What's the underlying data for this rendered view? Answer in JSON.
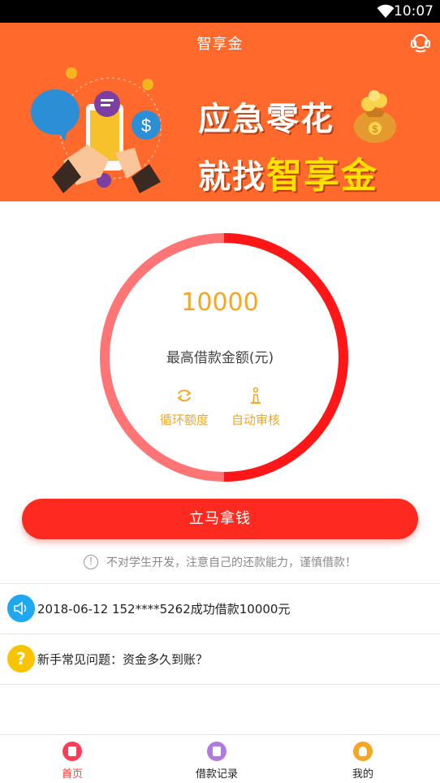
{
  "status_bar": {
    "time": "10:07"
  },
  "header": {
    "title": "智享金",
    "slogan_line1": "应急零花",
    "slogan_line2_prefix": "就找",
    "slogan_line2_highlight": "智享金"
  },
  "loan": {
    "amount": "10000",
    "amount_label": "最高借款金额(元)",
    "features": [
      {
        "label": "循环额度",
        "icon": "cycle-icon"
      },
      {
        "label": "自动审核",
        "icon": "chess-icon"
      }
    ],
    "cta_label": "立马拿钱",
    "warning": "不对学生开发，注意自己的还款能力，谨慎借款！"
  },
  "notices": [
    {
      "icon": "speaker-icon",
      "text": "2018-06-12 152****5262成功借款10000元"
    },
    {
      "icon": "help-icon",
      "icon_glyph": "?",
      "text": "新手常见问题：资金多久到账？"
    }
  ],
  "tabbar": {
    "items": [
      {
        "label": "首页",
        "active": true
      },
      {
        "label": "借款记录",
        "active": false
      },
      {
        "label": "我的",
        "active": false
      }
    ]
  },
  "colors": {
    "header_bg": "#ff6a2c",
    "accent_red": "#ff2a1f",
    "amount_orange": "#f5a623",
    "highlight_yellow": "#ffe100"
  }
}
